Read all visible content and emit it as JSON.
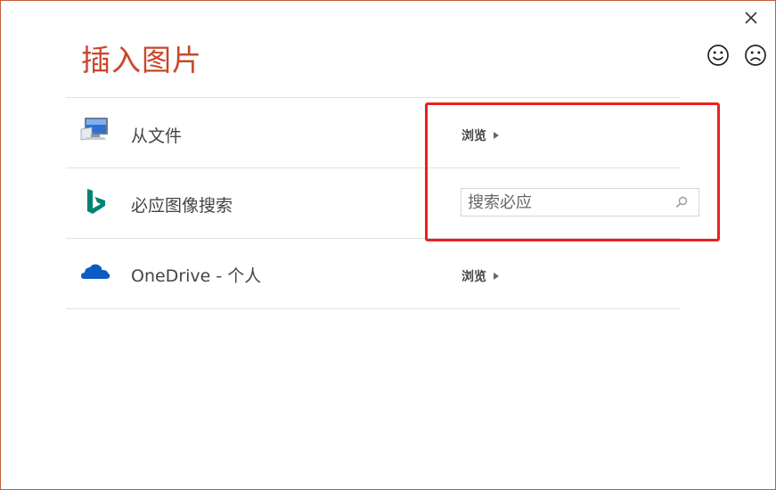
{
  "dialog": {
    "title": "插入图片"
  },
  "rows": [
    {
      "label": "从文件",
      "action_label": "浏览"
    },
    {
      "label": "必应图像搜索",
      "search_placeholder": "搜索必应"
    },
    {
      "label": "OneDrive - 个人",
      "action_label": "浏览"
    }
  ],
  "colors": {
    "title": "#c8472b",
    "border": "#c45a3c",
    "highlight": "#e8231c",
    "bing": "#008373",
    "onedrive": "#0a5bc4"
  }
}
